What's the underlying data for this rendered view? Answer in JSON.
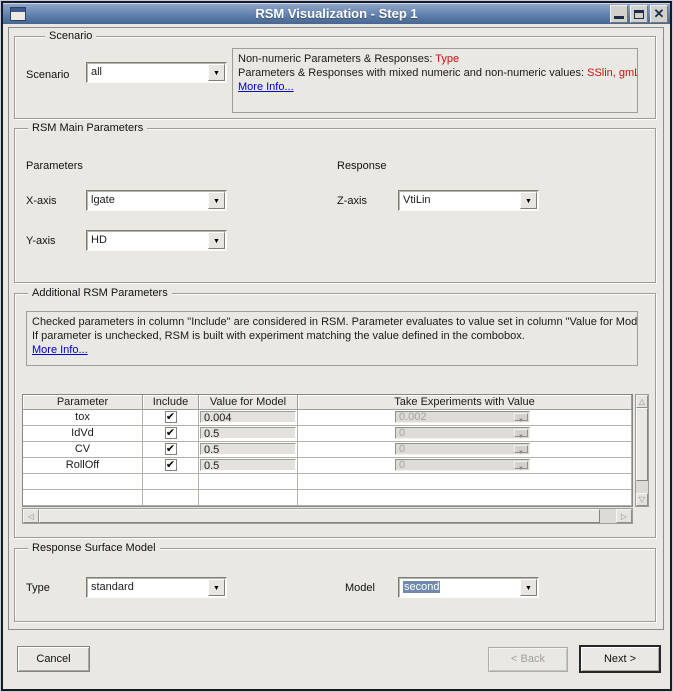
{
  "window": {
    "title": "RSM Visualization - Step 1"
  },
  "glyphs": {
    "combo_arrow": "▼",
    "check": "✔",
    "close": "✕",
    "scroll_up": "△",
    "scroll_down": "▽",
    "scroll_left": "◁",
    "scroll_right": "▷"
  },
  "colors": {
    "titlebar_top": "#8ea6c9",
    "titlebar_bottom": "#47658f",
    "background": "#e9e8e3",
    "alert_red": "#cc1111",
    "link_blue": "#0000cc",
    "selection": "#7089ad"
  },
  "scenario": {
    "legend": "Scenario",
    "label": "Scenario",
    "value": "all",
    "info": {
      "line1_label": "Non-numeric Parameters & Responses: ",
      "line1_value": "Type",
      "line2_label": "Parameters & Responses with mixed numeric and non-numeric values: ",
      "line2_value": "SSlin, gmLin",
      "more_info": "More Info..."
    }
  },
  "main_params": {
    "legend": "RSM Main Parameters",
    "parameters_header": "Parameters",
    "response_header": "Response",
    "x_label": "X-axis",
    "x_value": "lgate",
    "y_label": "Y-axis",
    "y_value": "HD",
    "z_label": "Z-axis",
    "z_value": "VtiLin"
  },
  "additional": {
    "legend": "Additional RSM Parameters",
    "info_line1": "Checked parameters in column \"Include\" are considered in RSM. Parameter evaluates to value set in column \"Value for Model\".",
    "info_line2": "If parameter is unchecked, RSM is built with experiment matching the value defined in the combobox.",
    "more_info": "More Info...",
    "table": {
      "headers": [
        "Parameter",
        "Include",
        "Value for Model",
        "Take Experiments with Value"
      ],
      "rows": [
        {
          "param": "tox",
          "included": true,
          "value": "0.004",
          "experiment": "0.002"
        },
        {
          "param": "IdVd",
          "included": true,
          "value": "0.5",
          "experiment": "0"
        },
        {
          "param": "CV",
          "included": true,
          "value": "0.5",
          "experiment": "0"
        },
        {
          "param": "RollOff",
          "included": true,
          "value": "0.5",
          "experiment": "0"
        }
      ]
    }
  },
  "rsm_model": {
    "legend": "Response Surface Model",
    "type_label": "Type",
    "type_value": "standard",
    "model_label": "Model",
    "model_value": "second"
  },
  "buttons": {
    "cancel": "Cancel",
    "back": "< Back",
    "next": "Next >"
  }
}
